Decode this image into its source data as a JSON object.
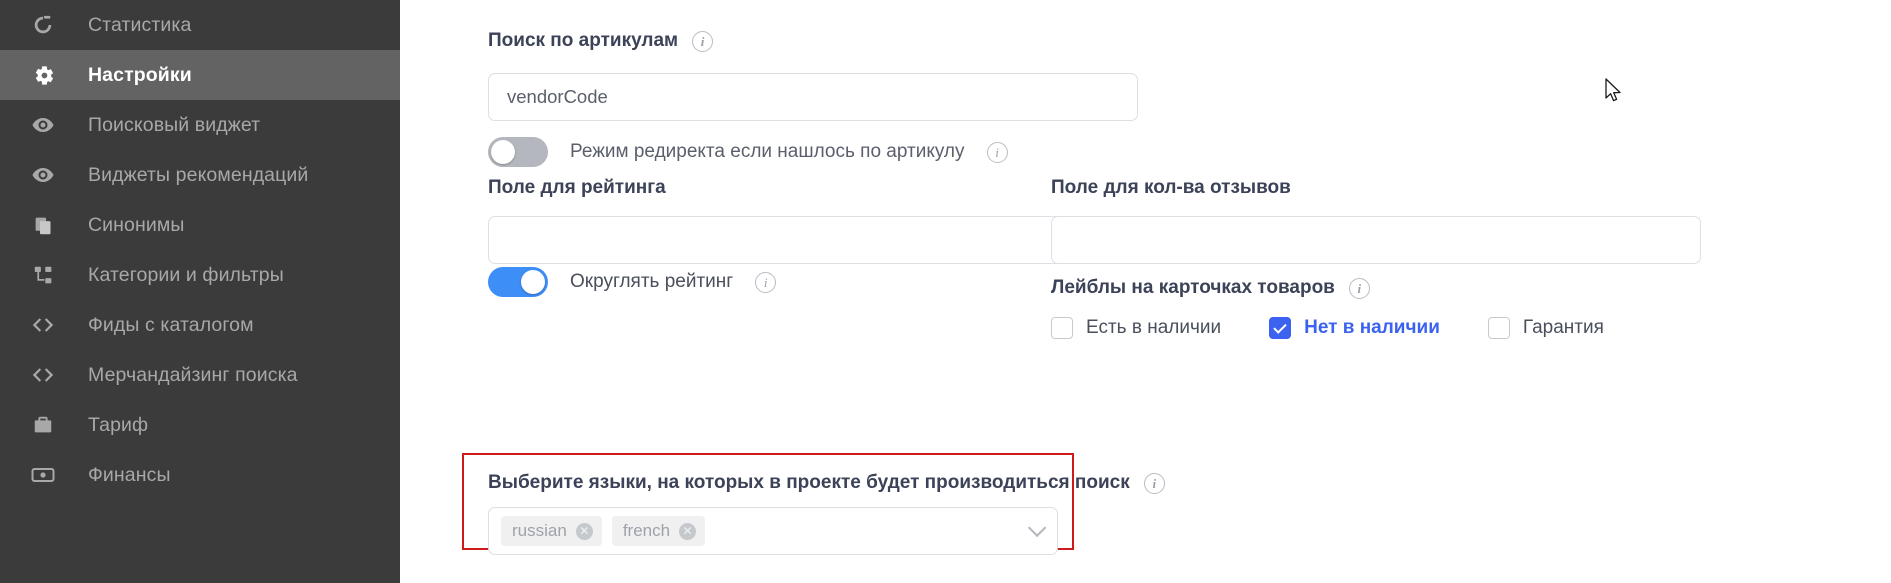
{
  "sidebar": {
    "items": [
      {
        "label": "Статистика",
        "icon": "chart-refresh-icon",
        "active": false
      },
      {
        "label": "Настройки",
        "icon": "gear-icon",
        "active": true
      },
      {
        "label": "Поисковый виджет",
        "icon": "eye-icon",
        "active": false
      },
      {
        "label": "Виджеты рекомендаций",
        "icon": "eye-icon",
        "active": false
      },
      {
        "label": "Синонимы",
        "icon": "copy-icon",
        "active": false
      },
      {
        "label": "Категории и фильтры",
        "icon": "sitemap-icon",
        "active": false
      },
      {
        "label": "Фиды с каталогом",
        "icon": "code-brackets-icon",
        "active": false
      },
      {
        "label": "Мерчандайзинг поиска",
        "icon": "code-brackets-icon",
        "active": false
      },
      {
        "label": "Тариф",
        "icon": "briefcase-icon",
        "active": false
      },
      {
        "label": "Финансы",
        "icon": "banknote-icon",
        "active": false
      }
    ]
  },
  "main": {
    "vendor_search": {
      "label": "Поиск по артикулам",
      "info_glyph": "i",
      "value": "vendorCode",
      "placeholder": ""
    },
    "redirect_toggle": {
      "label": "Режим редиректа если нашлось по артикулу",
      "state": "off",
      "info_glyph": "i"
    },
    "rating_field": {
      "label": "Поле для рейтинга",
      "value": "",
      "placeholder": ""
    },
    "reviews_field": {
      "label": "Поле для кол-ва отзывов",
      "value": "",
      "placeholder": ""
    },
    "round_rating_toggle": {
      "label": "Округлять рейтинг",
      "state": "on",
      "info_glyph": "i"
    },
    "product_labels": {
      "label": "Лейблы на карточках товаров",
      "info_glyph": "i",
      "checkboxes": [
        {
          "label": "Есть в наличии",
          "checked": false
        },
        {
          "label": "Нет в наличии",
          "checked": true
        },
        {
          "label": "Гарантия",
          "checked": false
        }
      ]
    },
    "languages": {
      "label": "Выберите языки, на которых в проекте будет производиться поиск",
      "info_glyph": "i",
      "tags": [
        {
          "label": "russian",
          "remove_glyph": "✕"
        },
        {
          "label": "french",
          "remove_glyph": "✕"
        }
      ],
      "highlight_color": "#d01919"
    }
  },
  "colors": {
    "sidebar_bg": "#3b3b3b",
    "sidebar_active_bg": "#636363",
    "accent_blue": "#3b63f0",
    "toggle_on": "#3e8ef7",
    "highlight_red": "#d01919"
  }
}
